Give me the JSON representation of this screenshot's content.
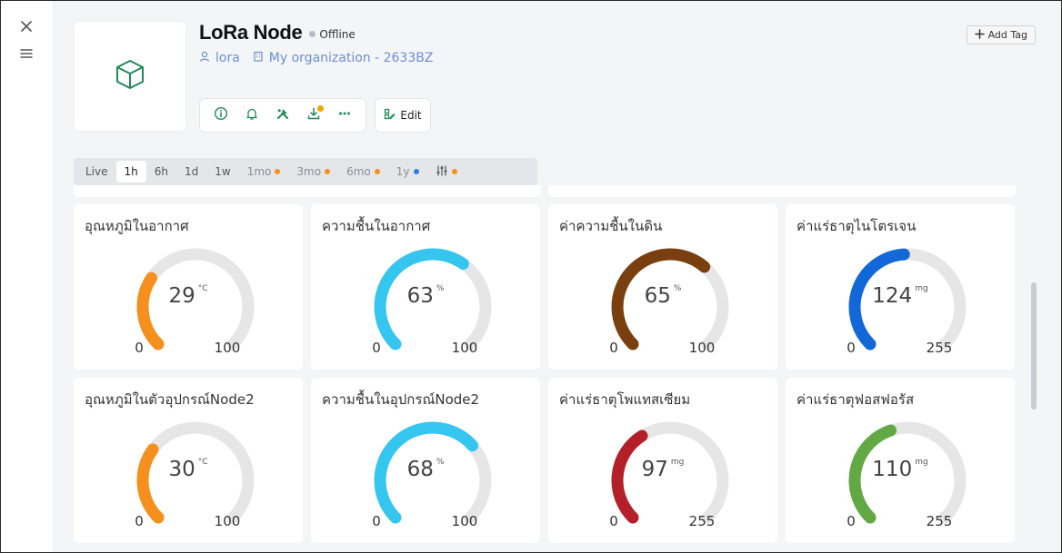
{
  "header": {
    "title": "LoRa Node",
    "status": "Offline",
    "user": "lora",
    "organization": "My organization - 2633BZ",
    "edit_label": "Edit",
    "add_tag_label": "Add Tag",
    "actions": [
      "info-icon",
      "bell-icon",
      "tools-icon",
      "download-icon",
      "more-icon"
    ]
  },
  "timeframe": {
    "tabs": [
      {
        "label": "Live"
      },
      {
        "label": "1h",
        "active": true
      },
      {
        "label": "6h"
      },
      {
        "label": "1d"
      },
      {
        "label": "1w"
      },
      {
        "label": "1mo"
      },
      {
        "label": "3mo"
      },
      {
        "label": "6mo"
      },
      {
        "label": "1y"
      }
    ]
  },
  "widgets": [
    {
      "title": "อุณหภูมิในอากาศ",
      "value": "29",
      "unit": "°C",
      "min": "0",
      "max": "100",
      "color": "#f5901e"
    },
    {
      "title": "ความชื้นในอากาศ",
      "value": "63",
      "unit": "%",
      "min": "0",
      "max": "100",
      "color": "#35c6ef"
    },
    {
      "title": "ค่าความชื้นในดิน",
      "value": "65",
      "unit": "%",
      "min": "0",
      "max": "100",
      "color": "#7a3f0f"
    },
    {
      "title": "ค่าแร่ธาตุไนโตรเจน",
      "value": "124",
      "unit": "mg",
      "min": "0",
      "max": "255",
      "color": "#1268d6"
    },
    {
      "title": "อุณหภูมิในตัวอุปกรณ์Node2",
      "value": "30",
      "unit": "°C",
      "min": "0",
      "max": "100",
      "color": "#f5901e"
    },
    {
      "title": "ความชื้นในอุปกรณ์Node2",
      "value": "68",
      "unit": "%",
      "min": "0",
      "max": "100",
      "color": "#35c6ef"
    },
    {
      "title": "ค่าแร่ธาตุโพแทสเซียม",
      "value": "97",
      "unit": "mg",
      "min": "0",
      "max": "255",
      "color": "#b3202a"
    },
    {
      "title": "ค่าแร่ธาตุฟอสฟอรัส",
      "value": "110",
      "unit": "mg",
      "min": "0",
      "max": "255",
      "color": "#62a844"
    }
  ]
}
